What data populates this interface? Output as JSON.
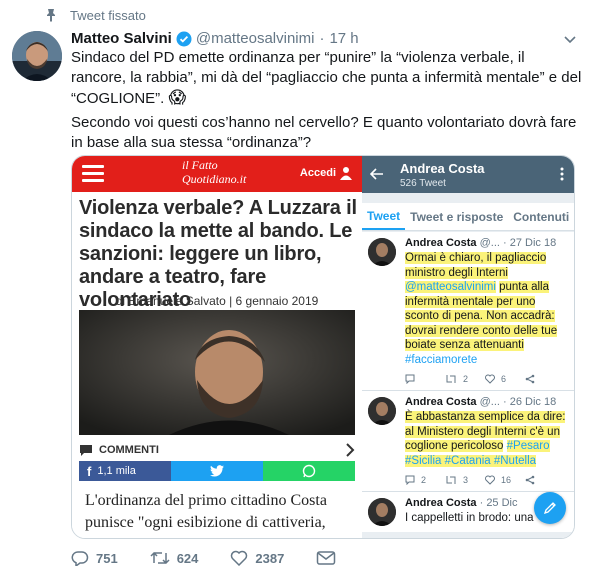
{
  "pinned_label": "Tweet fissato",
  "author": {
    "name": "Matteo Salvini",
    "handle": "@matteosalvinimi",
    "separator": "·",
    "time": "17 h"
  },
  "tweet": {
    "line1": "Sindaco del PD emette ordinanza per “punire” la “violenza verbale, il rancore, la rabbia”, mi dà del “pagliaccio che punta a infermità mentale” e del “COGLIONE”.",
    "emoji": "😱",
    "line2": "Secondo voi questi cos’hanno nel cervello? E quanto volontariato dovrà fare in base alla sua stessa “ordinanza”?"
  },
  "article": {
    "logo": "il Fatto Quotidiano.it",
    "accedi": "Accedi",
    "headline": "Violenza verbale? A Luzzara il sindaco la mette al bando. Le sanzioni: leggere un libro, andare a teatro, fare volontariato",
    "byline": "di Emanuele Salvato | 6 gennaio 2019",
    "comments_label": "COMMENTI",
    "fb_count": "1,1 mila",
    "body": "L'ordinanza del primo cittadino Costa punisce \"ogni esibizione di cattiveria,"
  },
  "profile": {
    "name": "Andrea Costa",
    "tweet_count": "526 Tweet",
    "tabs": [
      "Tweet",
      "Tweet e risposte",
      "Contenuti"
    ],
    "tweets": [
      {
        "name": "Andrea Costa",
        "handle": "@...",
        "date": "· 27 Dic 18",
        "text_a": "Ormai è chiaro, il pagliaccio ministro degli Interni",
        "mention": "@matteosalvinimi",
        "text_b": "punta alla infermità mentale per uno sconto di pena. Non accadrà: dovrai rendere conto delle tue boiate senza attenuanti",
        "hashtags": "#facciamorete",
        "retweets": "2",
        "likes": "6"
      },
      {
        "name": "Andrea Costa",
        "handle": "@...",
        "date": "· 26 Dic 18",
        "text_a": "È abbastanza semplice da dire: al Ministero degli Interni c'è un coglione pericoloso",
        "hashtags": "#Pesaro #Sicilia #Catania #Nutella",
        "replies": "2",
        "retweets": "3",
        "likes": "16"
      },
      {
        "name": "Andrea Costa",
        "handle": "@...",
        "date": "· 25 Dic",
        "text_a": "I cappelletti in brodo: una"
      }
    ]
  },
  "actions": {
    "replies": "751",
    "retweets": "624",
    "likes": "2387"
  },
  "colors": {
    "twitter_blue": "#1da1f2",
    "fatto_red": "#e21f1a",
    "highlight": "#fbf37a"
  }
}
